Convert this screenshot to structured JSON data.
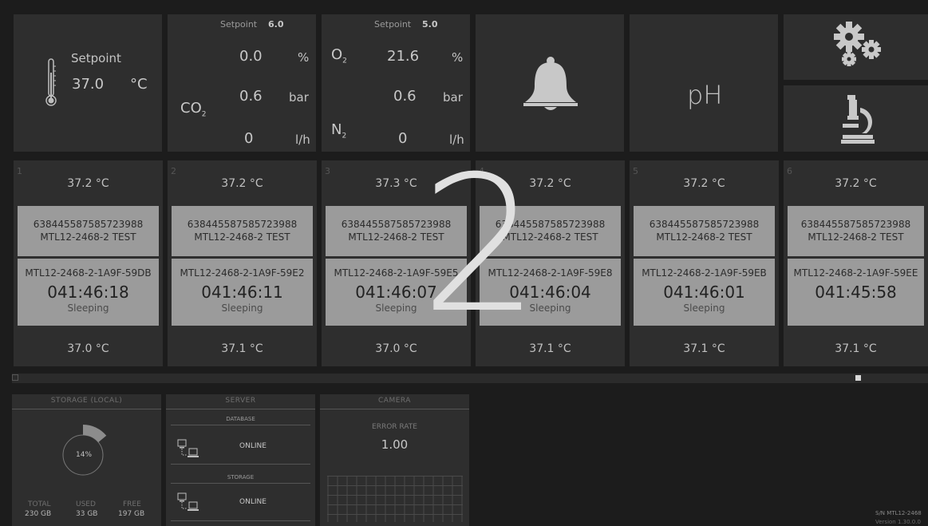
{
  "temperature_tile": {
    "setpoint_label": "Setpoint",
    "setpoint_value": "37.0",
    "unit": "°C",
    "icon": "thermometer-icon"
  },
  "co2_tile": {
    "setpoint_label": "Setpoint",
    "setpoint_value": "6.0",
    "gas_label": "CO",
    "gas_sub": "2",
    "concentration": "0.0",
    "concentration_unit": "%",
    "pressure": "0.6",
    "pressure_unit": "bar",
    "flow": "0",
    "flow_unit": "l/h"
  },
  "o2_tile": {
    "setpoint_label": "Setpoint",
    "setpoint_value": "5.0",
    "gas_label": "O",
    "gas_sub": "2",
    "gas2_label": "N",
    "gas2_sub": "2",
    "concentration": "21.6",
    "concentration_unit": "%",
    "pressure": "0.6",
    "pressure_unit": "bar",
    "flow": "0",
    "flow_unit": "l/h"
  },
  "alarm_tile": {
    "icon": "bell-icon"
  },
  "ph_tile": {
    "label": "pH"
  },
  "settings_tile": {
    "icon": "gears-icon"
  },
  "microscope_tile": {
    "icon": "microscope-icon"
  },
  "overlay": {
    "number": "2"
  },
  "cards": [
    {
      "index": "1",
      "temp_top": "37.2 °C",
      "barcode": "6384455875857239​88",
      "line2": "MTL12-2468-2 TEST",
      "slot_id": "MTL12-2468-2-1A9F-59DB",
      "time": "041:46:18",
      "state": "Sleeping",
      "temp_bottom": "37.0 °C"
    },
    {
      "index": "2",
      "temp_top": "37.2 °C",
      "barcode": "638445587585723988",
      "line2": "MTL12-2468-2 TEST",
      "slot_id": "MTL12-2468-2-1A9F-59E2",
      "time": "041:46:11",
      "state": "Sleeping",
      "temp_bottom": "37.1 °C"
    },
    {
      "index": "3",
      "temp_top": "37.3 °C",
      "barcode": "638445587585723988",
      "line2": "MTL12-2468-2 TEST",
      "slot_id": "MTL12-2468-2-1A9F-59E5",
      "time": "041:46:07",
      "state": "Sleeping",
      "temp_bottom": "37.0 °C"
    },
    {
      "index": "4",
      "temp_top": "37.2 °C",
      "barcode": "638445587585723988",
      "line2": "MTL12-2468-2 TEST",
      "slot_id": "MTL12-2468-2-1A9F-59E8",
      "time": "041:46:04",
      "state": "Sleeping",
      "temp_bottom": "37.1 °C"
    },
    {
      "index": "5",
      "temp_top": "37.2 °C",
      "barcode": "638445587585723988",
      "line2": "MTL12-2468-2 TEST",
      "slot_id": "MTL12-2468-2-1A9F-59EB",
      "time": "041:46:01",
      "state": "Sleeping",
      "temp_bottom": "37.1 °C"
    },
    {
      "index": "6",
      "temp_top": "37.2 °C",
      "barcode": "638445587585723988",
      "line2": "MTL12-2468-2 TEST",
      "slot_id": "MTL12-2468-2-1A9F-59EE",
      "time": "041:45:58",
      "state": "",
      "temp_bottom": "37.1 °C"
    }
  ],
  "storage": {
    "title": "STORAGE (LOCAL)",
    "percent": "14%",
    "used_fraction": 0.14,
    "total_label": "TOTAL",
    "total_value": "230 GB",
    "used_label": "USED",
    "used_value": "33 GB",
    "free_label": "FREE",
    "free_value": "197 GB"
  },
  "server": {
    "title": "SERVER",
    "database_label": "DATABASE",
    "database_status": "ONLINE",
    "storage_label": "STORAGE",
    "storage_status": "ONLINE"
  },
  "camera": {
    "title": "CAMERA",
    "error_rate_label": "ERROR RATE",
    "error_rate_value": "1.00"
  },
  "footer": {
    "serial": "S/N MTL12-2468",
    "version": "Version 1.30.0.0"
  },
  "colors": {
    "background": "#1c1c1c",
    "tile": "#2e2e2e",
    "card_inner": "#9b9b9b",
    "text": "#bdbdbd"
  }
}
